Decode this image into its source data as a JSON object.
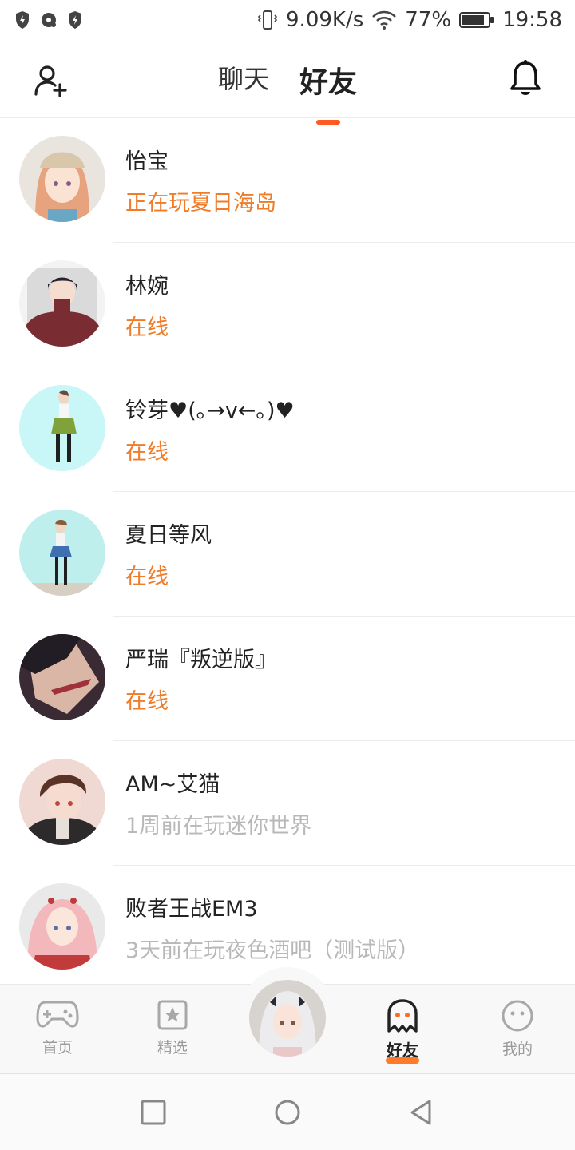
{
  "status_bar": {
    "net_speed": "9.09K/s",
    "battery": "77%",
    "time": "19:58"
  },
  "header": {
    "tabs": [
      "聊天",
      "好友"
    ],
    "active_tab": "好友",
    "add_friend_icon": "add-user-icon",
    "bell_icon": "bell-icon"
  },
  "friends": [
    {
      "name": "怡宝",
      "status": "正在玩夏日海岛"
    },
    {
      "name": "林婉",
      "status": "在线"
    },
    {
      "name": "铃芽♥(｡→v←｡)♥",
      "status": "在线"
    },
    {
      "name": "夏日等风",
      "status": "在线"
    },
    {
      "name": "严瑞『叛逆版』",
      "status": "在线"
    },
    {
      "name": "AM~艾猫",
      "status": "1周前在玩迷你世界"
    },
    {
      "name": "败者王战EM3",
      "status": "3天前在玩夜色酒吧（测试版）"
    }
  ],
  "bottom_nav": {
    "items": [
      "首页",
      "精选",
      "好友",
      "我的"
    ],
    "active": "好友"
  },
  "colors": {
    "accent": "#ff5a1f",
    "online": "#f07b28",
    "offline": "#b8b8b8"
  }
}
